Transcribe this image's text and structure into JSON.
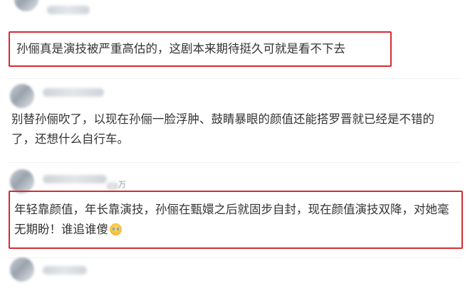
{
  "comments": [
    {
      "text": "孙俪真是演技被严重高估的，这剧本来期待挺久可就是看不下去",
      "highlighted": true
    },
    {
      "text": "别替孙俪吹了，以现在孙俪一脸浮肿、鼓睛暴眼的颜值还能搭罗晋就已经是不错的了，还想什么自行车。",
      "highlighted": false
    },
    {
      "name_suffix": "万",
      "text": "年轻靠颜值，年长靠演技，孙俪在甄嬛之后就固步自封，现在颜值演技双降，对她毫无期盼！谁追谁傻",
      "emoji": "crying-laughing-emoji",
      "highlighted": true
    }
  ],
  "colors": {
    "highlight_border": "#d62b34",
    "text": "#333333"
  }
}
